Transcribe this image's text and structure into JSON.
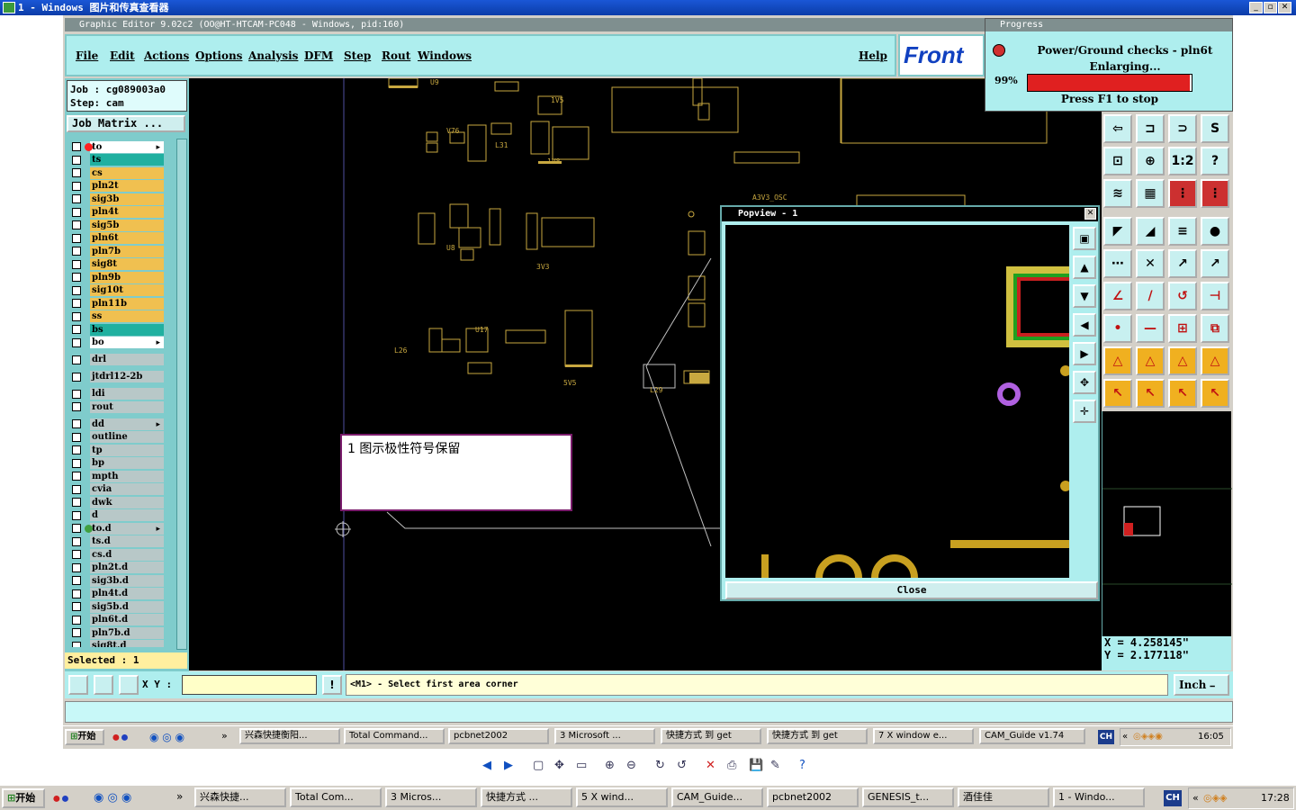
{
  "window": {
    "title": "1 - Windows 图片和传真查看器"
  },
  "editor": {
    "title": "Graphic Editor 9.02c2 (OO@HT-HTCAM-PC048 - Windows, pid:160)"
  },
  "menu": {
    "file": "File",
    "edit": "Edit",
    "actions": "Actions",
    "options": "Options",
    "analysis": "Analysis",
    "dfm": "DFM",
    "step": "Step",
    "rout": "Rout",
    "windows": "Windows",
    "help": "Help",
    "logo": "Front"
  },
  "job": {
    "job": "Job : cg089003a0",
    "step": "Step: cam",
    "matrix": "Job Matrix ..."
  },
  "layers": [
    {
      "name": "to",
      "color": "#ffffff",
      "dot": "#ff2020",
      "arrow": true
    },
    {
      "name": "ts",
      "color": "#20b0a0"
    },
    {
      "name": "cs",
      "color": "#f0c050"
    },
    {
      "name": "pln2t",
      "color": "#f0c050"
    },
    {
      "name": "sig3b",
      "color": "#f0c050"
    },
    {
      "name": "pln4t",
      "color": "#f0c050"
    },
    {
      "name": "sig5b",
      "color": "#f0c050"
    },
    {
      "name": "pln6t",
      "color": "#f0c050"
    },
    {
      "name": "pln7b",
      "color": "#f0c050"
    },
    {
      "name": "sig8t",
      "color": "#f0c050"
    },
    {
      "name": "pln9b",
      "color": "#f0c050"
    },
    {
      "name": "sig10t",
      "color": "#f0c050"
    },
    {
      "name": "pln11b",
      "color": "#f0c050"
    },
    {
      "name": "ss",
      "color": "#f0c050"
    },
    {
      "name": "bs",
      "color": "#20b0a0"
    },
    {
      "name": "bo",
      "color": "#ffffff",
      "arrow": true
    },
    {
      "name": "",
      "color": "#7fcccc",
      "gap": true
    },
    {
      "name": "drl",
      "color": "#b8c8c8"
    },
    {
      "name": "",
      "color": "#7fcccc",
      "gap": true
    },
    {
      "name": "jtdrl12-2b",
      "color": "#b8c8c8"
    },
    {
      "name": "",
      "color": "#7fcccc",
      "gap": true
    },
    {
      "name": "ldi",
      "color": "#b8c8c8"
    },
    {
      "name": "rout",
      "color": "#b8c8c8"
    },
    {
      "name": "",
      "color": "#7fcccc",
      "gap": true
    },
    {
      "name": "dd",
      "color": "#b8c8c8",
      "arrow": true
    },
    {
      "name": "outline",
      "color": "#b8c8c8"
    },
    {
      "name": "tp",
      "color": "#b8c8c8"
    },
    {
      "name": "bp",
      "color": "#b8c8c8"
    },
    {
      "name": "mpth",
      "color": "#b8c8c8"
    },
    {
      "name": "cvia",
      "color": "#b8c8c8"
    },
    {
      "name": "dwk",
      "color": "#b8c8c8"
    },
    {
      "name": "d",
      "color": "#b8c8c8"
    },
    {
      "name": "to.d",
      "color": "#b8c8c8",
      "dot": "#40a040",
      "arrow": true
    },
    {
      "name": "ts.d",
      "color": "#b8c8c8"
    },
    {
      "name": "cs.d",
      "color": "#b8c8c8"
    },
    {
      "name": "pln2t.d",
      "color": "#b8c8c8"
    },
    {
      "name": "sig3b.d",
      "color": "#b8c8c8"
    },
    {
      "name": "pln4t.d",
      "color": "#b8c8c8"
    },
    {
      "name": "sig5b.d",
      "color": "#b8c8c8"
    },
    {
      "name": "pln6t.d",
      "color": "#b8c8c8"
    },
    {
      "name": "pln7b.d",
      "color": "#b8c8c8"
    },
    {
      "name": "sig8t.d",
      "color": "#b8c8c8"
    }
  ],
  "selected": "Selected : 1",
  "progress": {
    "title": "Progress",
    "line1": "Power/Ground checks - pln6t",
    "line2": "Enlarging...",
    "percent": "99%",
    "percent_value": 99,
    "stop": "Press F1 to stop"
  },
  "popview": {
    "title": "Popview - 1",
    "close": "Close"
  },
  "coords": {
    "x": "X = 4.258145\"",
    "y": "Y = 2.177118\""
  },
  "bottom": {
    "xy_label": "X Y :",
    "xy_value": "",
    "prompt": "<M1> - Select first area corner",
    "units": "Inch"
  },
  "note": "1 图示极性符号保留",
  "pcb_labels": [
    "U9",
    "1V5",
    "V76",
    "L31",
    "1V8",
    "U8",
    "3V3",
    "U17",
    "L26",
    "5V5",
    "A3V3_OSC",
    "L29"
  ],
  "taskbar1": {
    "start": "开始",
    "items": [
      "兴森快捷衡阳...",
      "Total Command...",
      "pcbnet2002",
      "3 Microsoft ...",
      "快捷方式 到 get",
      "快捷方式 到 get",
      "7 X window e...",
      "CAM_Guide v1.74"
    ],
    "lang": "CH",
    "time": "16:05"
  },
  "taskbar2": {
    "start": "开始",
    "items": [
      "兴森快捷...",
      "Total Com...",
      "3 Micros...",
      "快捷方式 ...",
      "5 X wind...",
      "CAM_Guide...",
      "pcbnet2002",
      "GENESIS_t...",
      "酒佳佳",
      "1 - Windo..."
    ],
    "lang": "CH",
    "time": "17:28"
  }
}
